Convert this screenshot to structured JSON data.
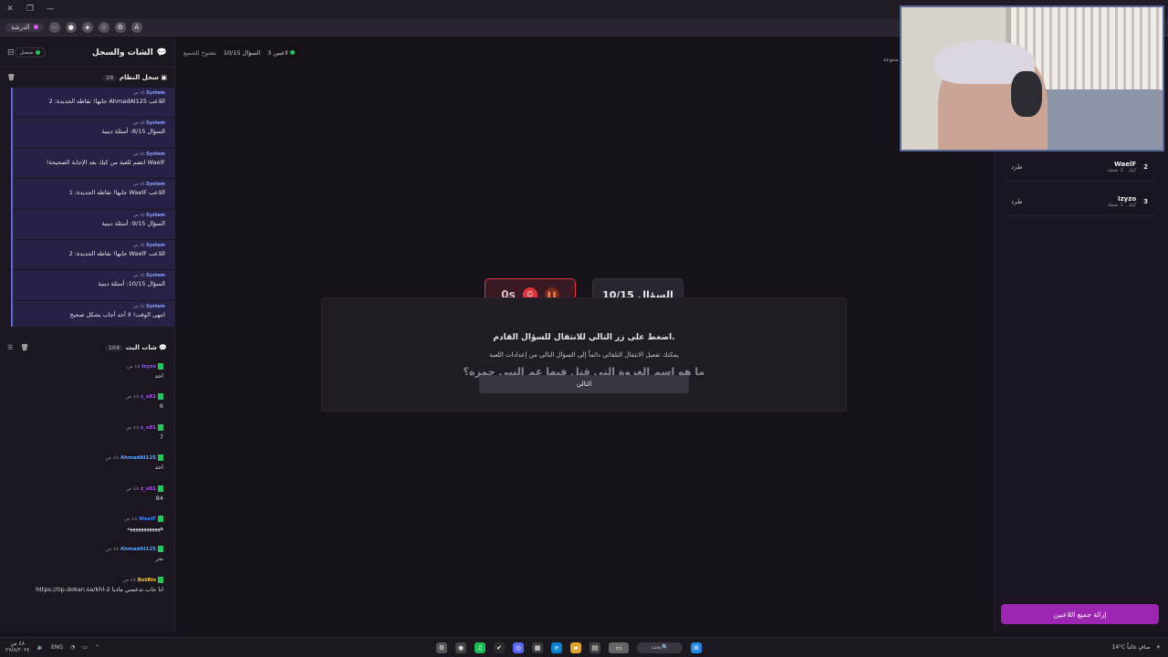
{
  "browser": {
    "profile": "الدرشة"
  },
  "sidebar": {
    "title": "الشات والسجل",
    "status": "متصل",
    "system_log": {
      "title": "سجل النظام",
      "count": "26",
      "items": [
        {
          "who": "System",
          "time": "٤٥ ص",
          "text": "اللاعب AhmadAl125 جابها! نقاطه الجديدة: 2"
        },
        {
          "who": "System",
          "time": "٤٥ ص",
          "text": "السؤال 8/15: أسئلة دينية"
        },
        {
          "who": "System",
          "time": "٤٥ ص",
          "text": "WaelF انضم للعبة من كيك بعد الإجابة الصحيحة!"
        },
        {
          "who": "System",
          "time": "٤٥ ص",
          "text": "اللاعب WaelF جابها! نقاطه الجديدة: 1"
        },
        {
          "who": "System",
          "time": "٤٥ ص",
          "text": "السؤال 9/15: أسئلة دينية"
        },
        {
          "who": "System",
          "time": "٤٥ ص",
          "text": "اللاعب WaelF جابها! نقاطه الجديدة: 2"
        },
        {
          "who": "System",
          "time": "٤٥ ص",
          "text": "السؤال 10/15: أسئلة دينية"
        },
        {
          "who": "System",
          "time": "٤٥ ص",
          "text": "انتهى الوقت! لا أحد أجاب بشكل صحيح"
        }
      ]
    },
    "bot_chat": {
      "title": "شات البث",
      "count": "104",
      "items": [
        {
          "user": "Izyzo",
          "time": "٤٨ ص",
          "text": "احد",
          "color": "#8b5cf6"
        },
        {
          "user": "z_x81",
          "time": "٤٨ ص",
          "text": "6",
          "color": "#a855f7"
        },
        {
          "user": "z_x81",
          "time": "٤٨ ص",
          "text": "7",
          "color": "#a855f7"
        },
        {
          "user": "AhmadAl125",
          "time": "٤٨ ص",
          "text": "احد",
          "color": "#60a5fa"
        },
        {
          "user": "z_x81",
          "time": "٤٨ ص",
          "text": "84",
          "color": "#a855f7"
        },
        {
          "user": "WaelF",
          "time": "٤٨ ص",
          "text": "ههههههههههههه",
          "color": "#3b82f6"
        },
        {
          "user": "AhmadAl125",
          "time": "٤٨ ص",
          "text": "بدر",
          "color": "#60a5fa"
        },
        {
          "user": "BotRix",
          "time": "٤٨ ص",
          "text": "https://tip.dokan.sa/khl-2 انا حاب تدعمني ماديا",
          "color": "#facc15"
        }
      ]
    }
  },
  "main": {
    "players_count": "3 لاعبين",
    "question_progress": "السؤال 10/15",
    "open_label": "مفتوح للجميع",
    "timer": "0s",
    "question_badge": "السؤال 10/15",
    "overlay_line1": "اضغط على زر التالي للانتقال للسؤال القادم.",
    "overlay_line2": "يمكنك تفعيل الانتقال التلقائي دائماً إلى السؤال التالي من إعدادات اللعبة",
    "question_text": "ما هو اسم الغزوة التي قتل فيها عم النبي حمزة؟",
    "next_button": "التالي"
  },
  "right_panel": {
    "partial_label": "متنوعة",
    "players": [
      {
        "rank": "2",
        "name": "WaelF",
        "meta": "كيك · 2 نقطة",
        "kick": "طرد"
      },
      {
        "rank": "3",
        "name": "Izyzo",
        "meta": "كيك · 1 نقطة",
        "kick": "طرد"
      }
    ],
    "remove_all": "إزالة جميع اللاعبين"
  },
  "taskbar": {
    "lang": "ENG",
    "search": "بحث",
    "weather": "14°C صافٍ غالباً",
    "time": "٤٨ ص",
    "date": "٢٧/٨/٢٠٢٤"
  },
  "colors": {
    "accent": "#9b27b0",
    "timer_red": "#e0353f",
    "log_bg": "#262145",
    "twitch_green": "#22c55e"
  }
}
